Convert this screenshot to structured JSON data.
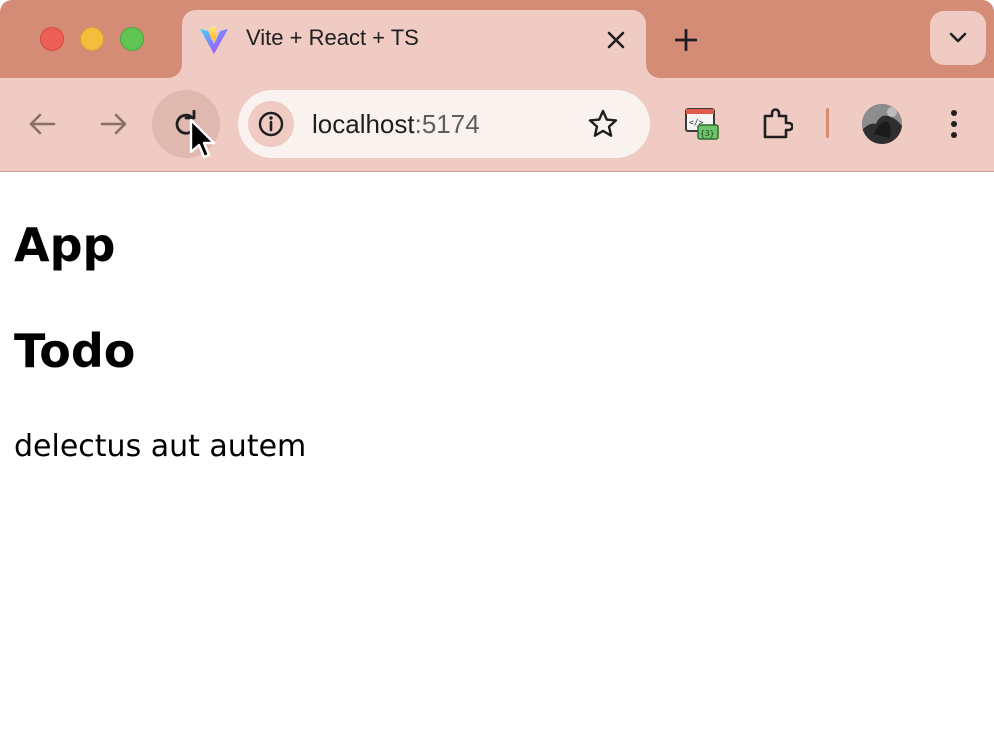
{
  "browser": {
    "tab": {
      "title": "Vite + React + TS",
      "favicon": "vite-logo-icon"
    },
    "omnibox": {
      "host": "localhost",
      "port": ":5174"
    },
    "colors": {
      "tabstrip": "#d48c76",
      "toolbar": "#efcbc3",
      "omnibox": "#f9f2ef"
    }
  },
  "page": {
    "heading": "App",
    "subheading": "Todo",
    "todo_title": "delectus aut autem"
  }
}
